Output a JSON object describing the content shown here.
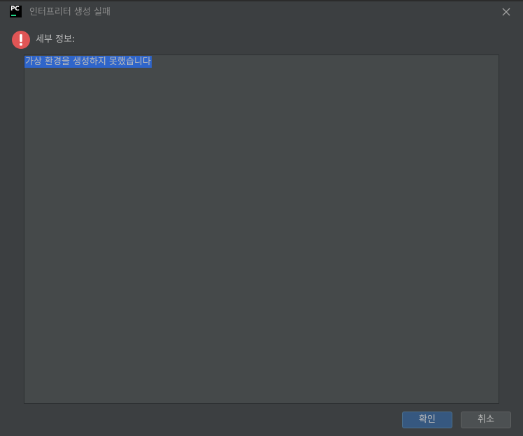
{
  "window": {
    "title": "인터프리터 생성 실패",
    "app_icon": "pycharm-icon",
    "close_icon": "close-icon"
  },
  "alert": {
    "icon": "error-exclamation-icon",
    "label": "세부 정보:"
  },
  "details": {
    "text": "가상 환경을 생성하지 못했습니다"
  },
  "buttons": {
    "ok_label": "확인",
    "cancel_label": "취소"
  },
  "colors": {
    "background": "#3c3f41",
    "details_background": "#45494a",
    "selection": "#2f65ca",
    "primary_button": "#365880",
    "error_icon": "#e05555"
  }
}
